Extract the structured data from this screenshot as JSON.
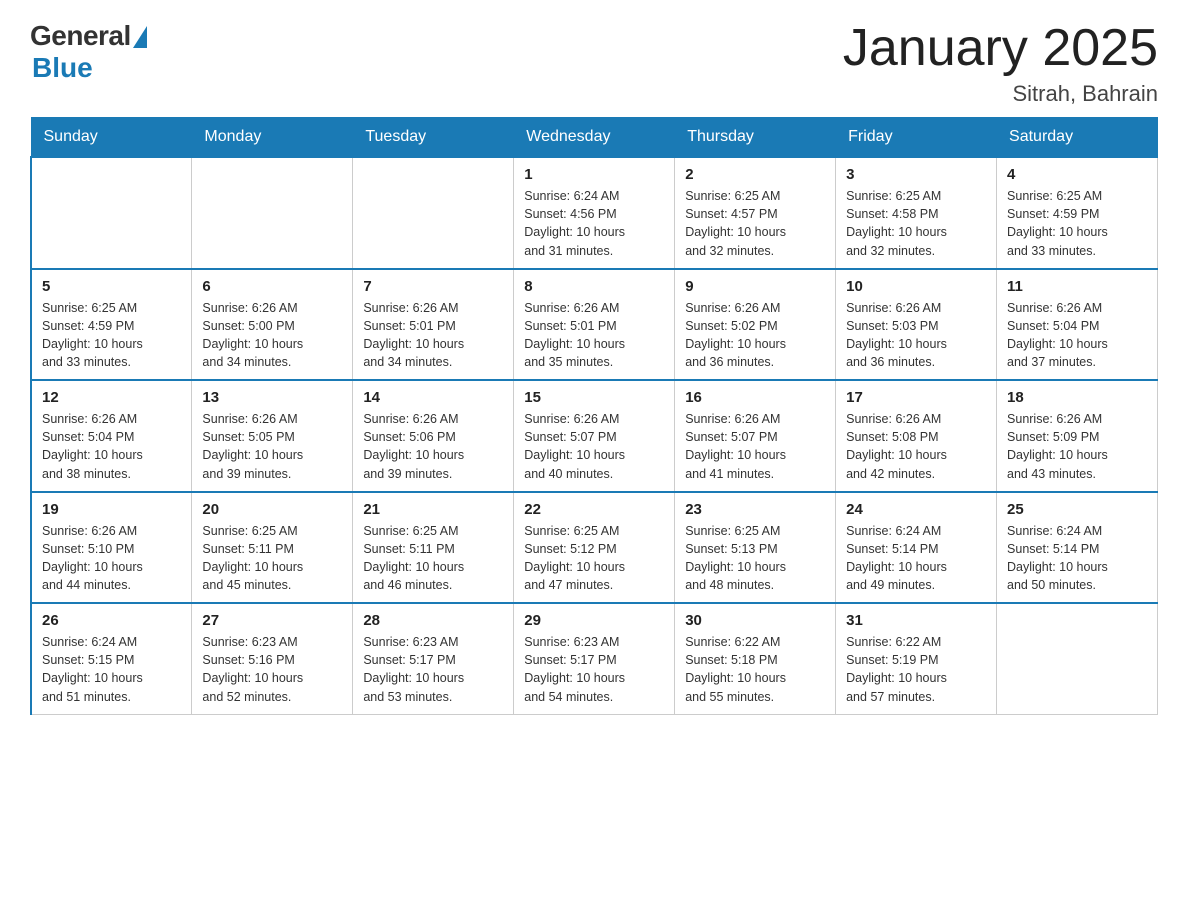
{
  "logo": {
    "general": "General",
    "blue": "Blue"
  },
  "title": "January 2025",
  "location": "Sitrah, Bahrain",
  "days_of_week": [
    "Sunday",
    "Monday",
    "Tuesday",
    "Wednesday",
    "Thursday",
    "Friday",
    "Saturday"
  ],
  "weeks": [
    [
      {
        "day": "",
        "info": ""
      },
      {
        "day": "",
        "info": ""
      },
      {
        "day": "",
        "info": ""
      },
      {
        "day": "1",
        "info": "Sunrise: 6:24 AM\nSunset: 4:56 PM\nDaylight: 10 hours\nand 31 minutes."
      },
      {
        "day": "2",
        "info": "Sunrise: 6:25 AM\nSunset: 4:57 PM\nDaylight: 10 hours\nand 32 minutes."
      },
      {
        "day": "3",
        "info": "Sunrise: 6:25 AM\nSunset: 4:58 PM\nDaylight: 10 hours\nand 32 minutes."
      },
      {
        "day": "4",
        "info": "Sunrise: 6:25 AM\nSunset: 4:59 PM\nDaylight: 10 hours\nand 33 minutes."
      }
    ],
    [
      {
        "day": "5",
        "info": "Sunrise: 6:25 AM\nSunset: 4:59 PM\nDaylight: 10 hours\nand 33 minutes."
      },
      {
        "day": "6",
        "info": "Sunrise: 6:26 AM\nSunset: 5:00 PM\nDaylight: 10 hours\nand 34 minutes."
      },
      {
        "day": "7",
        "info": "Sunrise: 6:26 AM\nSunset: 5:01 PM\nDaylight: 10 hours\nand 34 minutes."
      },
      {
        "day": "8",
        "info": "Sunrise: 6:26 AM\nSunset: 5:01 PM\nDaylight: 10 hours\nand 35 minutes."
      },
      {
        "day": "9",
        "info": "Sunrise: 6:26 AM\nSunset: 5:02 PM\nDaylight: 10 hours\nand 36 minutes."
      },
      {
        "day": "10",
        "info": "Sunrise: 6:26 AM\nSunset: 5:03 PM\nDaylight: 10 hours\nand 36 minutes."
      },
      {
        "day": "11",
        "info": "Sunrise: 6:26 AM\nSunset: 5:04 PM\nDaylight: 10 hours\nand 37 minutes."
      }
    ],
    [
      {
        "day": "12",
        "info": "Sunrise: 6:26 AM\nSunset: 5:04 PM\nDaylight: 10 hours\nand 38 minutes."
      },
      {
        "day": "13",
        "info": "Sunrise: 6:26 AM\nSunset: 5:05 PM\nDaylight: 10 hours\nand 39 minutes."
      },
      {
        "day": "14",
        "info": "Sunrise: 6:26 AM\nSunset: 5:06 PM\nDaylight: 10 hours\nand 39 minutes."
      },
      {
        "day": "15",
        "info": "Sunrise: 6:26 AM\nSunset: 5:07 PM\nDaylight: 10 hours\nand 40 minutes."
      },
      {
        "day": "16",
        "info": "Sunrise: 6:26 AM\nSunset: 5:07 PM\nDaylight: 10 hours\nand 41 minutes."
      },
      {
        "day": "17",
        "info": "Sunrise: 6:26 AM\nSunset: 5:08 PM\nDaylight: 10 hours\nand 42 minutes."
      },
      {
        "day": "18",
        "info": "Sunrise: 6:26 AM\nSunset: 5:09 PM\nDaylight: 10 hours\nand 43 minutes."
      }
    ],
    [
      {
        "day": "19",
        "info": "Sunrise: 6:26 AM\nSunset: 5:10 PM\nDaylight: 10 hours\nand 44 minutes."
      },
      {
        "day": "20",
        "info": "Sunrise: 6:25 AM\nSunset: 5:11 PM\nDaylight: 10 hours\nand 45 minutes."
      },
      {
        "day": "21",
        "info": "Sunrise: 6:25 AM\nSunset: 5:11 PM\nDaylight: 10 hours\nand 46 minutes."
      },
      {
        "day": "22",
        "info": "Sunrise: 6:25 AM\nSunset: 5:12 PM\nDaylight: 10 hours\nand 47 minutes."
      },
      {
        "day": "23",
        "info": "Sunrise: 6:25 AM\nSunset: 5:13 PM\nDaylight: 10 hours\nand 48 minutes."
      },
      {
        "day": "24",
        "info": "Sunrise: 6:24 AM\nSunset: 5:14 PM\nDaylight: 10 hours\nand 49 minutes."
      },
      {
        "day": "25",
        "info": "Sunrise: 6:24 AM\nSunset: 5:14 PM\nDaylight: 10 hours\nand 50 minutes."
      }
    ],
    [
      {
        "day": "26",
        "info": "Sunrise: 6:24 AM\nSunset: 5:15 PM\nDaylight: 10 hours\nand 51 minutes."
      },
      {
        "day": "27",
        "info": "Sunrise: 6:23 AM\nSunset: 5:16 PM\nDaylight: 10 hours\nand 52 minutes."
      },
      {
        "day": "28",
        "info": "Sunrise: 6:23 AM\nSunset: 5:17 PM\nDaylight: 10 hours\nand 53 minutes."
      },
      {
        "day": "29",
        "info": "Sunrise: 6:23 AM\nSunset: 5:17 PM\nDaylight: 10 hours\nand 54 minutes."
      },
      {
        "day": "30",
        "info": "Sunrise: 6:22 AM\nSunset: 5:18 PM\nDaylight: 10 hours\nand 55 minutes."
      },
      {
        "day": "31",
        "info": "Sunrise: 6:22 AM\nSunset: 5:19 PM\nDaylight: 10 hours\nand 57 minutes."
      },
      {
        "day": "",
        "info": ""
      }
    ]
  ]
}
